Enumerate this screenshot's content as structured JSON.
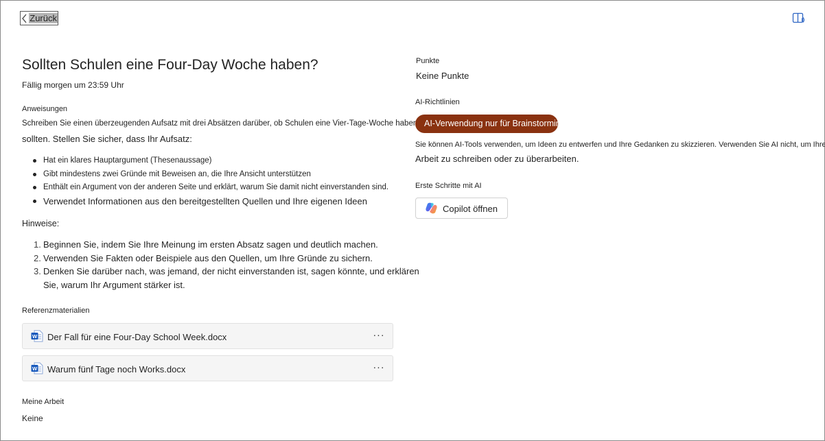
{
  "header": {
    "back_label": "Zurück",
    "back_icon": "chevron-left-icon",
    "reader_icon": "immersive-reader-icon"
  },
  "assignment": {
    "title": "Sollten Schulen eine Four-Day Woche haben?",
    "due": "Fällig morgen um 23:59 Uhr",
    "instructions_label": "Anweisungen",
    "instructions_p1": "Schreiben Sie einen überzeugenden Aufsatz mit drei Absätzen darüber, ob Schulen eine Vier-Tage-Woche haben",
    "instructions_p2": "sollten. Stellen Sie sicher, dass Ihr Aufsatz:",
    "bullets": [
      "Hat ein klares Hauptargument (Thesenaussage)",
      "Gibt mindestens zwei Gründe mit Beweisen an, die Ihre Ansicht unterstützen",
      "Enthält ein Argument von der anderen Seite und erklärt, warum Sie damit nicht einverstanden sind.",
      "Verwendet Informationen aus den bereitgestellten Quellen und Ihre eigenen Ideen"
    ],
    "hints_label": "Hinweise:",
    "hints": [
      {
        "num": "1.",
        "text": "Beginnen Sie, indem Sie Ihre Meinung im ersten Absatz sagen und deutlich machen."
      },
      {
        "num": "2.",
        "text": "Verwenden Sie Fakten oder Beispiele aus den Quellen, um Ihre Gründe zu sichern."
      },
      {
        "num": "3.",
        "text": "Denken Sie darüber nach, was jemand, der nicht einverstanden ist, sagen könnte, und erklären Sie, warum Ihr Argument stärker ist."
      }
    ],
    "references_label": "Referenzmaterialien",
    "references": [
      {
        "name": "Der Fall für eine Four-Day School Week.docx",
        "icon": "word-doc-icon",
        "more": "···"
      },
      {
        "name": "Warum fünf Tage noch Works.docx",
        "icon": "word-doc-icon",
        "more": "···"
      }
    ],
    "my_work_label": "Meine Arbeit",
    "my_work_value": "Keine"
  },
  "sidebar": {
    "points_label": "Punkte",
    "points_value": "Keine Punkte",
    "ai_guidelines_label": "AI-Richtlinien",
    "ai_pill": "AI-Verwendung nur für Brainstorming",
    "ai_pill_color": "#8a3210",
    "ai_desc_line1": "Sie können AI-Tools verwenden, um Ideen zu entwerfen und Ihre Gedanken zu skizzieren. Verwenden Sie AI nicht, um Ihre",
    "ai_desc_line2": "Arbeit zu schreiben oder zu überarbeiten.",
    "getting_started_label": "Erste Schritte mit AI",
    "copilot_button": "Copilot öffnen",
    "copilot_icon": "copilot-icon"
  }
}
